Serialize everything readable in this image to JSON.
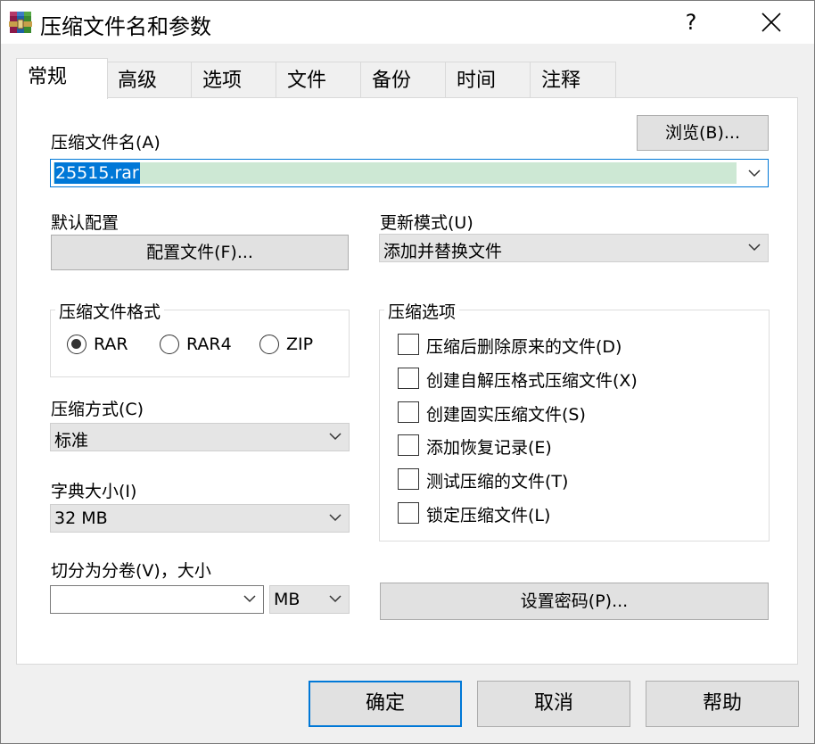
{
  "window": {
    "title": "压缩文件名和参数",
    "help": "?",
    "accent_color": "#0078d7"
  },
  "tabs": [
    {
      "label": "常规",
      "active": true
    },
    {
      "label": "高级"
    },
    {
      "label": "选项"
    },
    {
      "label": "文件"
    },
    {
      "label": "备份"
    },
    {
      "label": "时间"
    },
    {
      "label": "注释"
    }
  ],
  "general": {
    "archive_name_label": "压缩文件名(A)",
    "browse_button": "浏览(B)...",
    "archive_name_value": "25515.rar",
    "default_profile_label": "默认配置",
    "profiles_button": "配置文件(F)...",
    "update_mode_label": "更新模式(U)",
    "update_mode_value": "添加并替换文件",
    "format_group": {
      "title": "压缩文件格式",
      "options": [
        "RAR",
        "RAR4",
        "ZIP"
      ],
      "selected": "RAR"
    },
    "method_label": "压缩方式(C)",
    "method_value": "标准",
    "dictionary_label": "字典大小(I)",
    "dictionary_value": "32 MB",
    "split_label": "切分为分卷(V)，大小",
    "split_value": "",
    "split_unit": "MB",
    "options_group": {
      "title": "压缩选项",
      "items": [
        {
          "label": "压缩后删除原来的文件(D)",
          "checked": false
        },
        {
          "label": "创建自解压格式压缩文件(X)",
          "checked": false
        },
        {
          "label": "创建固实压缩文件(S)",
          "checked": false
        },
        {
          "label": "添加恢复记录(E)",
          "checked": false
        },
        {
          "label": "测试压缩的文件(T)",
          "checked": false
        },
        {
          "label": "锁定压缩文件(L)",
          "checked": false
        }
      ]
    },
    "password_button": "设置密码(P)..."
  },
  "footer": {
    "ok": "确定",
    "cancel": "取消",
    "help": "帮助"
  }
}
